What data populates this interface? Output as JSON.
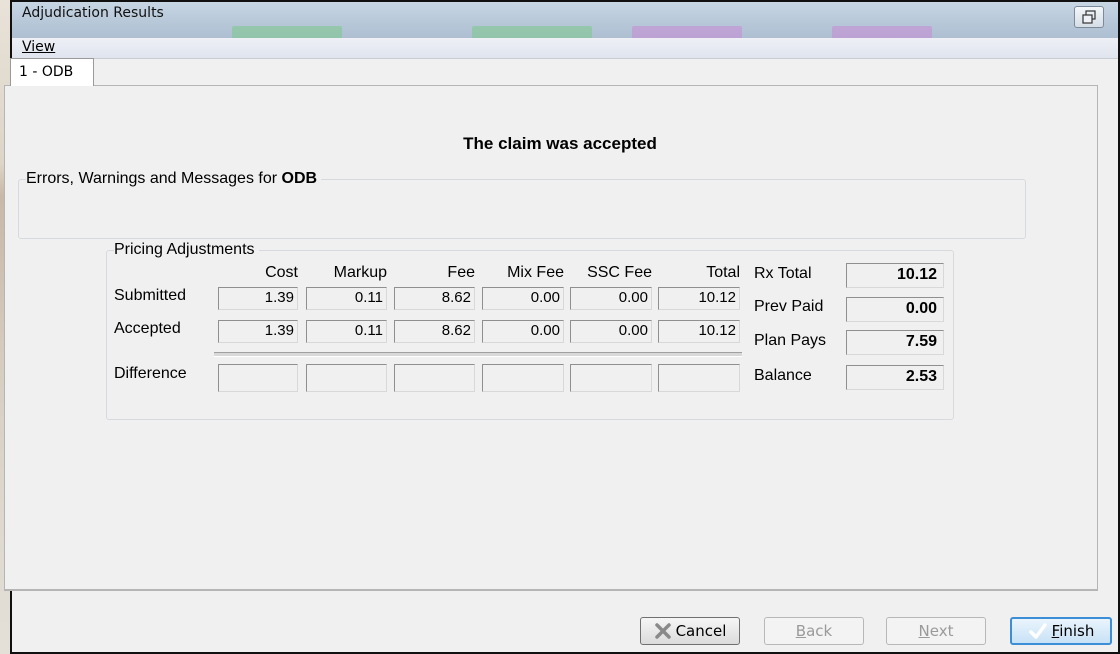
{
  "window": {
    "title": "Adjudication Results"
  },
  "menu": {
    "view_label": "View"
  },
  "tabs": [
    {
      "label": "1 - ODB"
    }
  ],
  "status": {
    "message": "The claim was accepted"
  },
  "errors_group": {
    "label": "Errors, Warnings and Messages for",
    "plan": "ODB"
  },
  "pricing": {
    "group_label": "Pricing Adjustments",
    "columns": [
      "Cost",
      "Markup",
      "Fee",
      "Mix Fee",
      "SSC Fee",
      "Total"
    ],
    "rows": [
      {
        "label": "Submitted",
        "values": [
          "1.39",
          "0.11",
          "8.62",
          "0.00",
          "0.00",
          "10.12"
        ]
      },
      {
        "label": "Accepted",
        "values": [
          "1.39",
          "0.11",
          "8.62",
          "0.00",
          "0.00",
          "10.12"
        ]
      },
      {
        "label": "Difference",
        "values": [
          "",
          "",
          "",
          "",
          "",
          ""
        ]
      }
    ]
  },
  "summary": [
    {
      "label": "Rx Total",
      "value": "10.12"
    },
    {
      "label": "Prev Paid",
      "value": "0.00"
    },
    {
      "label": "Plan Pays",
      "value": "7.59"
    },
    {
      "label": "Balance",
      "value": "2.53"
    }
  ],
  "buttons": {
    "cancel": "Cancel",
    "back": "Back",
    "next": "Next",
    "finish": "Finish"
  },
  "colors": {
    "default_button_border": "#3c8fd6",
    "cancel_icon": "#8a8a8a",
    "finish_icon": "#ffffff",
    "titlebar": "#b6c7d8"
  }
}
